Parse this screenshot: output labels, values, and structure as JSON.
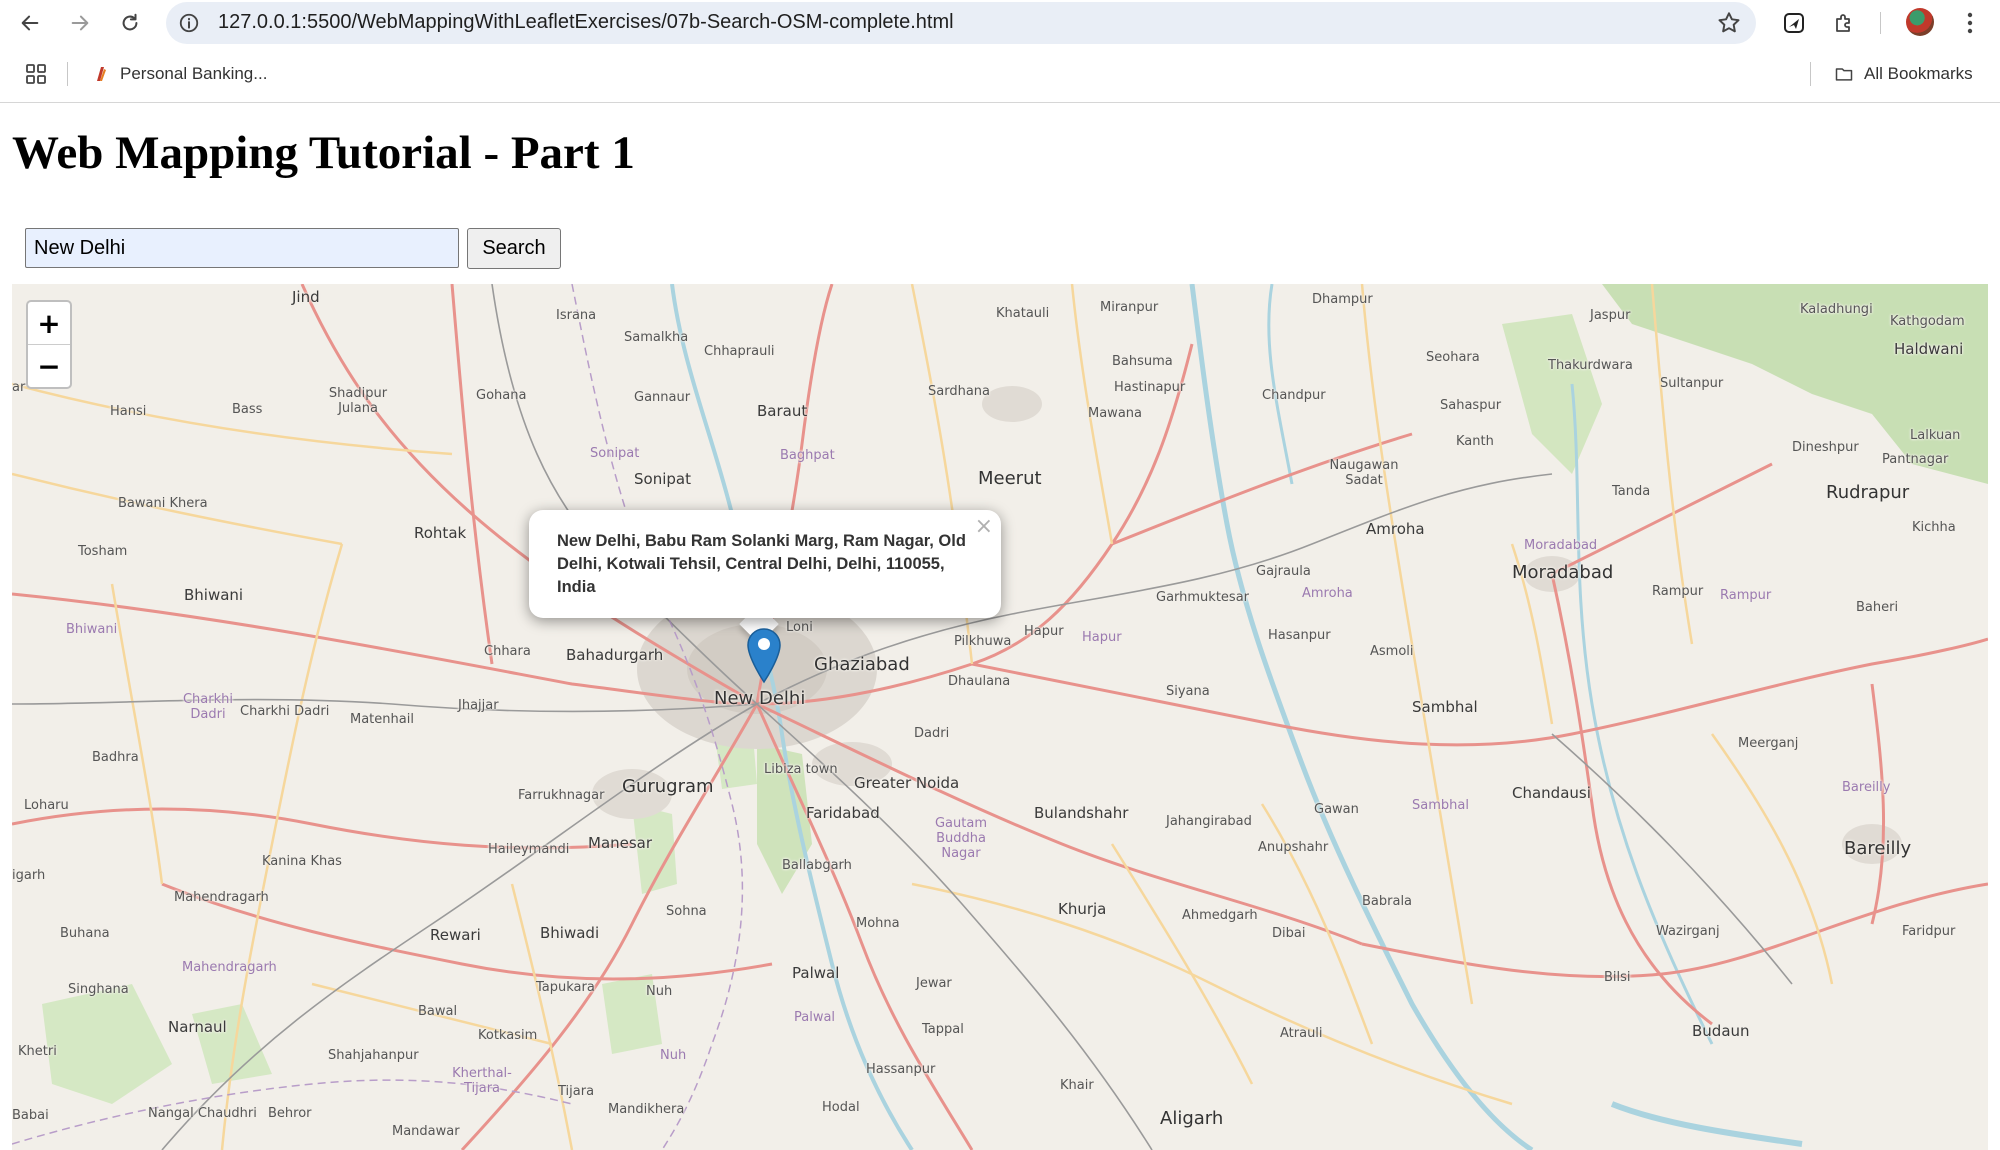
{
  "browser": {
    "url": "127.0.0.1:5500/WebMappingWithLeafletExercises/07b-Search-OSM-complete.html",
    "bookmarks": [
      {
        "label": "Personal Banking..."
      }
    ],
    "all_bookmarks_label": "All Bookmarks"
  },
  "page": {
    "title": "Web Mapping Tutorial - Part 1"
  },
  "search": {
    "value": "New Delhi",
    "button_label": "Search"
  },
  "map": {
    "zoom_in_label": "+",
    "zoom_out_label": "−",
    "popup": {
      "text": "New Delhi, Babu Ram Solanki Marg, Ram Nagar, Old Delhi, Kotwali Tehsil, Central Delhi, Delhi, 110055, India",
      "close_label": "×"
    },
    "labels": [
      {
        "text": "Jind",
        "cls": "med"
      },
      {
        "text": "Israna",
        "cls": "small"
      },
      {
        "text": "Samalkha",
        "cls": "small"
      },
      {
        "text": "Chhaprauli",
        "cls": "small"
      },
      {
        "text": "Khatauli",
        "cls": "small"
      },
      {
        "text": "Miranpur",
        "cls": "small"
      },
      {
        "text": "Dhampur",
        "cls": "small"
      },
      {
        "text": "Jaspur",
        "cls": "small"
      },
      {
        "text": "Kaladhungi",
        "cls": "small"
      },
      {
        "text": "Kathgodam",
        "cls": "small"
      },
      {
        "text": "Haldwani",
        "cls": "med"
      },
      {
        "text": "Seohara",
        "cls": "small"
      },
      {
        "text": "Thakurdwara",
        "cls": "small"
      },
      {
        "text": "Sultanpur",
        "cls": "small"
      },
      {
        "text": "Bahsuma",
        "cls": "small"
      },
      {
        "text": "Hastinapur",
        "cls": "small"
      },
      {
        "text": "Mawana",
        "cls": "small"
      },
      {
        "text": "Sardhana",
        "cls": "small"
      },
      {
        "text": "Baraut",
        "cls": "med"
      },
      {
        "text": "Gannaur",
        "cls": "small"
      },
      {
        "text": "Gohana",
        "cls": "small"
      },
      {
        "text": "Shadipur Julana",
        "cls": "small"
      },
      {
        "text": "Hansi",
        "cls": "small"
      },
      {
        "text": "Bass",
        "cls": "small"
      },
      {
        "text": "Chandpur",
        "cls": "small"
      },
      {
        "text": "Sahaspur",
        "cls": "small"
      },
      {
        "text": "Kanth",
        "cls": "small"
      },
      {
        "text": "Dineshpur",
        "cls": "small"
      },
      {
        "text": "Lalkuan",
        "cls": "small"
      },
      {
        "text": "Pantnagar",
        "cls": "small"
      },
      {
        "text": "Sonipat",
        "cls": "purple"
      },
      {
        "text": "Baghpat",
        "cls": "purple"
      },
      {
        "text": "Sonipat",
        "cls": "med"
      },
      {
        "text": "Meerut",
        "cls": "big"
      },
      {
        "text": "Naugawan Sadat",
        "cls": "small"
      },
      {
        "text": "Tanda",
        "cls": "small"
      },
      {
        "text": "Rudrapur",
        "cls": "big"
      },
      {
        "text": "Kichha",
        "cls": "small"
      },
      {
        "text": "Bawani Khera",
        "cls": "small"
      },
      {
        "text": "Rohtak",
        "cls": "med"
      },
      {
        "text": "Tosham",
        "cls": "small"
      },
      {
        "text": "Amroha",
        "cls": "med"
      },
      {
        "text": "Moradabad",
        "cls": "purple"
      },
      {
        "text": "Moradabad",
        "cls": "big"
      },
      {
        "text": "Gajraula",
        "cls": "small"
      },
      {
        "text": "Amroha",
        "cls": "purple"
      },
      {
        "text": "Garhmuktesar",
        "cls": "small"
      },
      {
        "text": "Rampur",
        "cls": "small"
      },
      {
        "text": "Rampur",
        "cls": "purple"
      },
      {
        "text": "Baheri",
        "cls": "small"
      },
      {
        "text": "Bhiwani",
        "cls": "med"
      },
      {
        "text": "Bhiwani",
        "cls": "purple"
      },
      {
        "text": "Loni",
        "cls": "small"
      },
      {
        "text": "Pilkhuwa",
        "cls": "small"
      },
      {
        "text": "Hapur",
        "cls": "small"
      },
      {
        "text": "Hapur",
        "cls": "purple"
      },
      {
        "text": "Hasanpur",
        "cls": "small"
      },
      {
        "text": "Asmoli",
        "cls": "small"
      },
      {
        "text": "Chhara",
        "cls": "small"
      },
      {
        "text": "Bahadurgarh",
        "cls": "med"
      },
      {
        "text": "Ghaziabad",
        "cls": "big"
      },
      {
        "text": "New Delhi",
        "cls": "big"
      },
      {
        "text": "Dhaulana",
        "cls": "small"
      },
      {
        "text": "Siyana",
        "cls": "small"
      },
      {
        "text": "Sambhal",
        "cls": "med"
      },
      {
        "text": "Charkhi Dadri",
        "cls": "purple"
      },
      {
        "text": "Charkhi Dadri",
        "cls": "small"
      },
      {
        "text": "Jhajjar",
        "cls": "small"
      },
      {
        "text": "Matenhail",
        "cls": "small"
      },
      {
        "text": "Dadri",
        "cls": "small"
      },
      {
        "text": "Meerganj",
        "cls": "small"
      },
      {
        "text": "Badhra",
        "cls": "small"
      },
      {
        "text": "Libiza town",
        "cls": "small"
      },
      {
        "text": "Greater Noida",
        "cls": "med"
      },
      {
        "text": "Gurugram",
        "cls": "big"
      },
      {
        "text": "Farrukhnagar",
        "cls": "small"
      },
      {
        "text": "Chandausi",
        "cls": "med"
      },
      {
        "text": "Bareilly",
        "cls": "purple"
      },
      {
        "text": "Loharu",
        "cls": "small"
      },
      {
        "text": "Faridabad",
        "cls": "med"
      },
      {
        "text": "Bulandshahr",
        "cls": "med"
      },
      {
        "text": "Jahangirabad",
        "cls": "small"
      },
      {
        "text": "Gawan",
        "cls": "small"
      },
      {
        "text": "Sambhal",
        "cls": "purple"
      },
      {
        "text": "Gautam Buddha Nagar",
        "cls": "purple"
      },
      {
        "text": "Haileymandi",
        "cls": "small"
      },
      {
        "text": "Manesar",
        "cls": "med"
      },
      {
        "text": "Anupshahr",
        "cls": "small"
      },
      {
        "text": "Bareilly",
        "cls": "big"
      },
      {
        "text": "Kanina Khas",
        "cls": "small"
      },
      {
        "text": "Ballabgarh",
        "cls": "small"
      },
      {
        "text": "Mahendragarh",
        "cls": "small"
      },
      {
        "text": "Babrala",
        "cls": "small"
      },
      {
        "text": "Khurja",
        "cls": "med"
      },
      {
        "text": "Sohna",
        "cls": "small"
      },
      {
        "text": "Ahmedgarh",
        "cls": "small"
      },
      {
        "text": "Mohna",
        "cls": "small"
      },
      {
        "text": "Buhana",
        "cls": "small"
      },
      {
        "text": "Rewari",
        "cls": "med"
      },
      {
        "text": "Bhiwadi",
        "cls": "med"
      },
      {
        "text": "Dibai",
        "cls": "small"
      },
      {
        "text": "Wazirganj",
        "cls": "small"
      },
      {
        "text": "Faridpur",
        "cls": "small"
      },
      {
        "text": "Mahendragarh",
        "cls": "purple"
      },
      {
        "text": "Palwal",
        "cls": "med"
      },
      {
        "text": "Jewar",
        "cls": "small"
      },
      {
        "text": "Bilsi",
        "cls": "small"
      },
      {
        "text": "Singhana",
        "cls": "small"
      },
      {
        "text": "Tapukara",
        "cls": "small"
      },
      {
        "text": "Nuh",
        "cls": "small"
      },
      {
        "text": "Bawal",
        "cls": "small"
      },
      {
        "text": "Narnaul",
        "cls": "med"
      },
      {
        "text": "Kotkasim",
        "cls": "small"
      },
      {
        "text": "Palwal",
        "cls": "purple"
      },
      {
        "text": "Tappal",
        "cls": "small"
      },
      {
        "text": "Atrauli",
        "cls": "small"
      },
      {
        "text": "Budaun",
        "cls": "med"
      },
      {
        "text": "Khetri",
        "cls": "small"
      },
      {
        "text": "Shahjahanpur",
        "cls": "small"
      },
      {
        "text": "Nuh",
        "cls": "purple"
      },
      {
        "text": "Hassanpur",
        "cls": "small"
      },
      {
        "text": "Kherthal-Tijara",
        "cls": "purple"
      },
      {
        "text": "Tijara",
        "cls": "small"
      },
      {
        "text": "Khair",
        "cls": "small"
      },
      {
        "text": "Nangal Chaudhri",
        "cls": "small"
      },
      {
        "text": "Behror",
        "cls": "small"
      },
      {
        "text": "Mandikhera",
        "cls": "small"
      },
      {
        "text": "Hodal",
        "cls": "small"
      },
      {
        "text": "Aligarh",
        "cls": "big"
      },
      {
        "text": "Mandawar",
        "cls": "small"
      },
      {
        "text": "Babai",
        "cls": "small"
      },
      {
        "text": "igarh",
        "cls": "small"
      },
      {
        "text": "ar",
        "cls": "small"
      }
    ]
  }
}
